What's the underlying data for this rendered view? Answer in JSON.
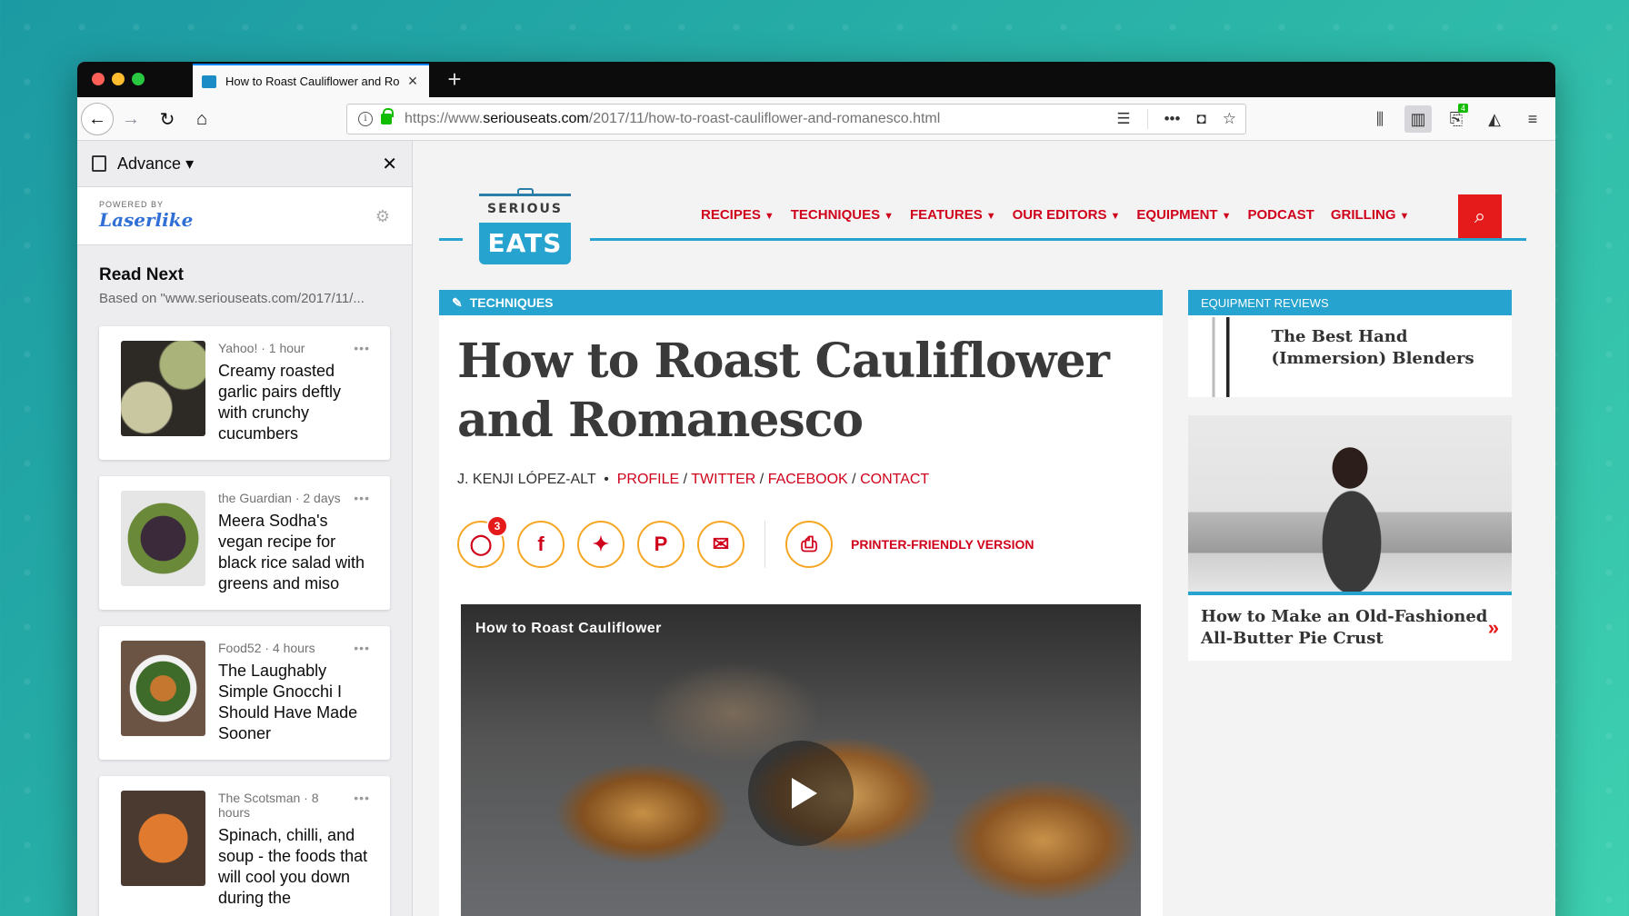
{
  "browser": {
    "tab_title": "How to Roast Cauliflower and Romanesco",
    "new_tab_label": "+",
    "url_prefix": "https://www.",
    "url_domain": "seriouseats.com",
    "url_path": "/2017/11/how-to-roast-cauliflower-and-romanesco.html",
    "notification_count": "4"
  },
  "sidebar": {
    "header_title": "Advance",
    "powered_by": "POWERED BY",
    "brand": "Laserlike",
    "read_next_title": "Read Next",
    "read_next_sub": "Based on \"www.seriouseats.com/2017/11/...",
    "cards": [
      {
        "source": "Yahoo! · 1 hour",
        "title": "Creamy roasted garlic pairs deftly with crunchy cucumbers"
      },
      {
        "source": "the Guardian · 2 days",
        "title": "Meera Sodha's vegan recipe for black rice salad with greens and miso"
      },
      {
        "source": "Food52 · 4 hours",
        "title": "The Laughably Simple Gnocchi I Should Have Made Sooner"
      },
      {
        "source": "The Scotsman · 8 hours",
        "title": "Spinach, chilli, and soup - the foods that will cool you down during the"
      }
    ]
  },
  "site": {
    "logo_top": "SERIOUS",
    "logo_bottom": "EATS",
    "nav": [
      "RECIPES",
      "TECHNIQUES",
      "FEATURES",
      "OUR EDITORS",
      "EQUIPMENT",
      "PODCAST",
      "GRILLING"
    ],
    "nav_has_caret": [
      true,
      true,
      true,
      true,
      true,
      false,
      true
    ]
  },
  "article": {
    "category": "TECHNIQUES",
    "title": "How to Roast Cauliflower and Romanesco",
    "author": "J. KENJI LÓPEZ-ALT",
    "links": [
      "PROFILE",
      "TWITTER",
      "FACEBOOK",
      "CONTACT"
    ],
    "comment_count": "3",
    "printer_label": "PRINTER-FRIENDLY VERSION",
    "video_title": "How to Roast Cauliflower"
  },
  "rail": {
    "section_label": "EQUIPMENT REVIEWS",
    "item1_title": "The Best Hand (Immersion) Blenders",
    "item2_title": "How to Make an Old-Fashioned All-Butter Pie Crust",
    "item2_arrow": "»"
  },
  "colors": {
    "accent_blue": "#27a3cf",
    "accent_red": "#d0021b"
  }
}
